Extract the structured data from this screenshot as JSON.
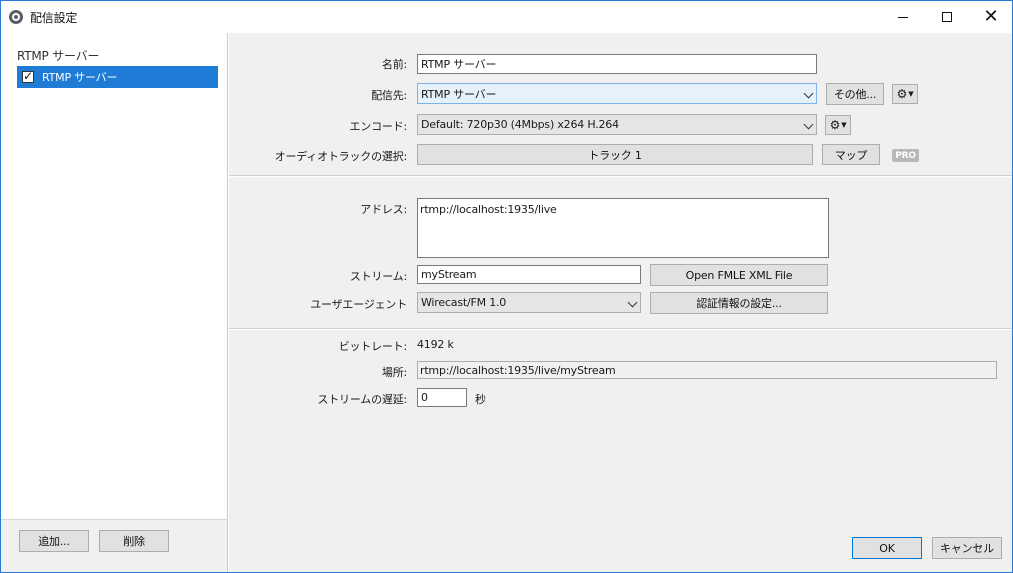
{
  "window": {
    "title": "配信設定",
    "controls": {
      "minimize": "",
      "maximize": "",
      "close": "✕"
    }
  },
  "sidebar": {
    "group_label": "RTMP サーバー",
    "items": [
      {
        "label": "RTMP サーバー",
        "checked": true,
        "selected": true
      }
    ],
    "add_button": "追加...",
    "delete_button": "削除"
  },
  "settings": {
    "name_label": "名前:",
    "name_value": "RTMP サーバー",
    "destination_label": "配信先:",
    "destination_value": "RTMP サーバー",
    "other_button": "その他...",
    "encoding_label": "エンコード:",
    "encoding_value": "Default: 720p30 (4Mbps) x264 H.264",
    "audio_track_label": "オーディオトラックの選択:",
    "audio_track_value": "トラック 1",
    "map_button": "マップ",
    "pro_badge": "PRO"
  },
  "server": {
    "address_label": "アドレス:",
    "address_value": "rtmp://localhost:1935/live",
    "stream_label": "ストリーム:",
    "stream_value": "myStream",
    "fmle_button": "Open FMLE XML File",
    "user_agent_label": "ユーザエージェント",
    "user_agent_value": "Wirecast/FM 1.0",
    "credentials_button": "認証情報の設定..."
  },
  "status": {
    "bitrate_label": "ビットレート:",
    "bitrate_value": "4192 k",
    "location_label": "場所:",
    "location_value": "rtmp://localhost:1935/live/myStream",
    "delay_label": "ストリームの遅延:",
    "delay_value": "0",
    "delay_unit": "秒"
  },
  "footer": {
    "ok_button": "OK",
    "cancel_button": "キャンセル"
  }
}
